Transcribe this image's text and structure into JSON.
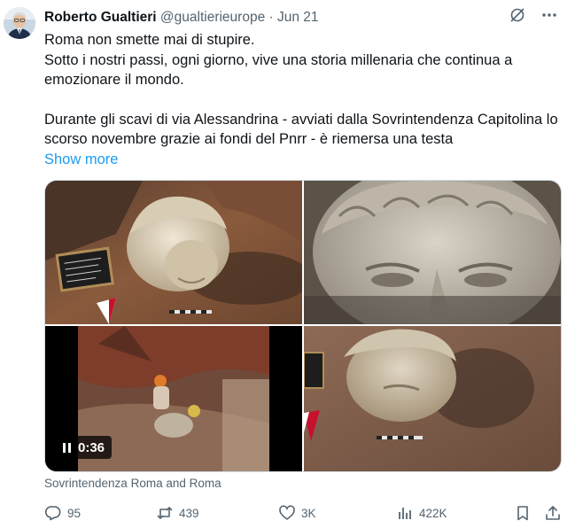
{
  "author": {
    "name": "Roberto Gualtieri",
    "handle": "@gualtierieurope",
    "separator": "·",
    "date": "Jun 21"
  },
  "tweet": {
    "line1": "Roma non smette mai di stupire.",
    "line2": "Sotto i nostri passi, ogni giorno, vive una storia millenaria che continua a emozionare il mondo.",
    "line3": "Durante gli scavi di via Alessandrina - avviati dalla Sovrintendenza Capitolina lo scorso novembre grazie ai fondi del Pnrr - è riemersa una testa",
    "show_more": "Show more"
  },
  "media": {
    "video_time": "0:36",
    "credit": "Sovrintendenza Roma and Roma"
  },
  "actions": {
    "replies": "95",
    "reposts": "439",
    "likes": "3K",
    "views": "422K"
  },
  "icons": [
    "grok-icon",
    "more-icon",
    "reply-icon",
    "repost-icon",
    "like-icon",
    "views-icon",
    "bookmark-icon",
    "share-icon"
  ],
  "colors": {
    "link": "#1d9bf0",
    "secondary": "#536471",
    "text": "#0f1419"
  }
}
